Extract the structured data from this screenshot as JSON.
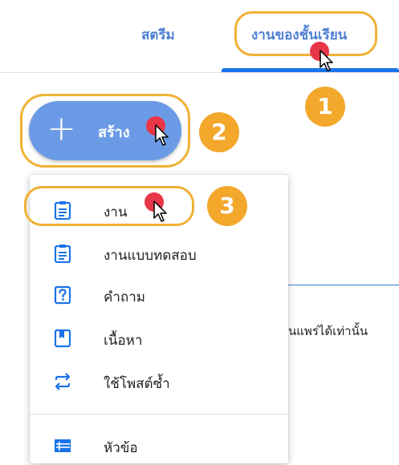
{
  "tabs": {
    "stream": "สตรีม",
    "classwork": "งานของชั้นเรียน"
  },
  "create_button": {
    "plus": "+",
    "label": "สร้าง"
  },
  "steps": [
    "1",
    "2",
    "3"
  ],
  "menu": {
    "items": [
      {
        "label": "งาน",
        "icon": "assignment-icon"
      },
      {
        "label": "งานแบบทดสอบ",
        "icon": "quiz-assignment-icon"
      },
      {
        "label": "คำถาม",
        "icon": "question-icon"
      },
      {
        "label": "เนื้อหา",
        "icon": "material-icon"
      },
      {
        "label": "ใช้โพสต์ซ้ำ",
        "icon": "reuse-post-icon"
      },
      {
        "label": "หัวข้อ",
        "icon": "topic-icon"
      }
    ]
  },
  "background": {
    "partial_text": "นแพร่ได้เท่านั้น"
  },
  "colors": {
    "accent_blue": "#1a73e8",
    "button_blue": "#6b9be6",
    "highlight_orange": "#efb135",
    "badge_orange": "#f3a82c",
    "cursor_dot_red": "#e9374a"
  }
}
